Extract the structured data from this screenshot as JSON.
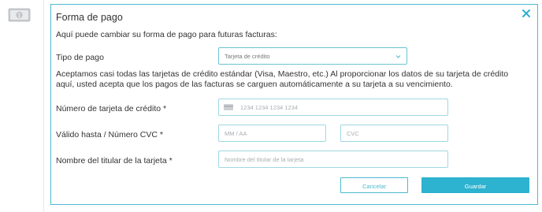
{
  "colors": {
    "accent": "#2db2cf",
    "border": "#4cb9cf",
    "text": "#333333",
    "placeholder": "#a8adb1"
  },
  "sidebar": {
    "icon": "money-icon"
  },
  "dialog": {
    "title": "Forma de pago",
    "subtitle": "Aquí puede cambiar su forma de pago para futuras facturas:",
    "close_icon": "close-icon"
  },
  "payment_type": {
    "label": "Tipo de pago",
    "selected": "Tarjeta de crédito",
    "caret_icon": "chevron-down-icon"
  },
  "info_text": "Aceptamos casi todas las tarjetas de crédito estándar (Visa, Maestro, etc.) Al proporcionar los datos de su tarjeta de crédito aquí, usted acepta que los pagos de las facturas se carguen automáticamente a su tarjeta a su vencimiento.",
  "card_number": {
    "label": "Número de tarjeta de crédito *",
    "placeholder": "1234 1234 1234 1234",
    "icon": "credit-card-icon"
  },
  "validity": {
    "label": "Válido hasta / Número CVC *",
    "expiry_placeholder": "MM / AA",
    "cvc_placeholder": "CVC"
  },
  "holder": {
    "label": "Nombre del titular de la tarjeta *",
    "placeholder": "Nombre del titular de la tarjeta"
  },
  "buttons": {
    "cancel": "Cancelar",
    "save": "Guardar"
  }
}
